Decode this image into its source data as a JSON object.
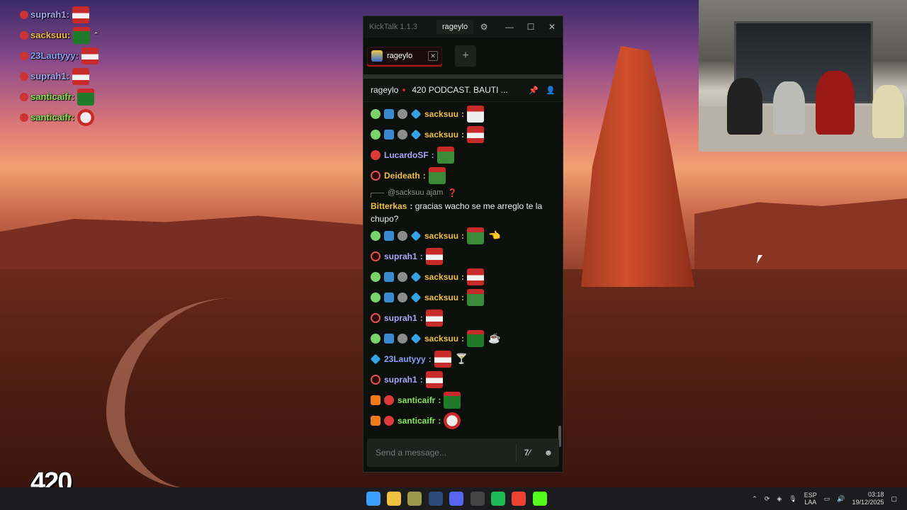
{
  "overlay_chat": [
    {
      "user": "suprah1",
      "color": "#a7a8f5",
      "emote": "em-red",
      "extra": ""
    },
    {
      "user": "sacksuu",
      "color": "#f0c040",
      "emote": "em-green",
      "extra": "ᵔ"
    },
    {
      "user": "23Lautyyy",
      "color": "#8fa2f5",
      "emote": "em-red",
      "extra": ""
    },
    {
      "user": "suprah1",
      "color": "#a7a8f5",
      "emote": "em-red",
      "extra": ""
    },
    {
      "user": "santicaifr",
      "color": "#8be45a",
      "emote": "em-green",
      "extra": ""
    },
    {
      "user": "santicaifr",
      "color": "#8be45a",
      "emote": "em-round",
      "extra": ""
    }
  ],
  "app": {
    "name": "KickTalk 1.1.3",
    "user_button": "rageylo",
    "gear_icon": "⚙",
    "min": "—",
    "max": "☐",
    "close": "✕"
  },
  "tab": {
    "label": "rageylo",
    "close": "✕",
    "add": "+"
  },
  "channel": {
    "name": "rageylo",
    "title": "420 PODCAST. BAUTI ...",
    "pin_icon": "📌",
    "user_icon": "👤"
  },
  "messages": [
    {
      "badges": [
        "b-bot",
        "b-ham",
        "b-coin",
        "b-gem"
      ],
      "user": "sacksuu",
      "color": "#f0c040",
      "emote": "em-white",
      "extra": ""
    },
    {
      "badges": [
        "b-bot",
        "b-ham",
        "b-coin",
        "b-gem"
      ],
      "user": "sacksuu",
      "color": "#f0c040",
      "emote": "em-red",
      "extra": ""
    },
    {
      "badges": [
        "b-skull"
      ],
      "user": "LucardoSF",
      "color": "#a7a8f5",
      "emote": "em-frog",
      "extra": ""
    },
    {
      "badges": [
        "b-ring"
      ],
      "user": "Deideath",
      "color": "#f0c040",
      "emote": "em-frog",
      "extra": ""
    }
  ],
  "reply": {
    "to": "@sacksuu",
    "text": "ajam",
    "icon": "❓"
  },
  "text_message": {
    "user": "Bitterkas",
    "text": "gracias wacho se me arreglo te la chupo?"
  },
  "messages2": [
    {
      "badges": [
        "b-bot",
        "b-ham",
        "b-coin",
        "b-gem"
      ],
      "user": "sacksuu",
      "color": "#f0c040",
      "emote": "em-frog",
      "extra": "👈"
    },
    {
      "badges": [
        "b-ring"
      ],
      "user": "suprah1",
      "color": "#a7a8f5",
      "emote": "em-red",
      "extra": ""
    },
    {
      "badges": [
        "b-bot",
        "b-ham",
        "b-coin",
        "b-gem"
      ],
      "user": "sacksuu",
      "color": "#f0c040",
      "emote": "em-red",
      "extra": ""
    },
    {
      "badges": [
        "b-bot",
        "b-ham",
        "b-coin",
        "b-gem"
      ],
      "user": "sacksuu",
      "color": "#f0c040",
      "emote": "em-frog",
      "extra": ""
    },
    {
      "badges": [
        "b-ring"
      ],
      "user": "suprah1",
      "color": "#a7a8f5",
      "emote": "em-red",
      "extra": ""
    },
    {
      "badges": [
        "b-bot",
        "b-ham",
        "b-coin",
        "b-gem"
      ],
      "user": "sacksuu",
      "color": "#f0c040",
      "emote": "em-green",
      "extra": "☕"
    },
    {
      "badges": [
        "b-gem"
      ],
      "user": "23Lautyyy",
      "color": "#8fa2f5",
      "emote": "em-red",
      "extra": "🍸"
    },
    {
      "badges": [
        "b-ring"
      ],
      "user": "suprah1",
      "color": "#a7a8f5",
      "emote": "em-red",
      "extra": ""
    },
    {
      "badges": [
        "b-7",
        "b-skull"
      ],
      "user": "santicaifr",
      "color": "#8be45a",
      "emote": "em-green",
      "extra": ""
    },
    {
      "badges": [
        "b-7",
        "b-skull"
      ],
      "user": "santicaifr",
      "color": "#8be45a",
      "emote": "em-round",
      "extra": ""
    }
  ],
  "input": {
    "placeholder": "Send a message...",
    "btn1": "7⁄"
  },
  "logo": "420",
  "taskbar": {
    "apps": [
      {
        "name": "windows-start-icon",
        "color": "#3aa0ff"
      },
      {
        "name": "file-explorer-icon",
        "color": "#f0c040"
      },
      {
        "name": "app-icon",
        "color": "#9a9a4a"
      },
      {
        "name": "steam-icon",
        "color": "#2a4a7a"
      },
      {
        "name": "discord-icon",
        "color": "#5865f2"
      },
      {
        "name": "obs-icon",
        "color": "#444"
      },
      {
        "name": "spotify-icon",
        "color": "#1db954"
      },
      {
        "name": "chrome-icon",
        "color": "#ea4335"
      },
      {
        "name": "kick-icon",
        "color": "#53fc18"
      }
    ],
    "lang_top": "ESP",
    "lang_bottom": "LAA",
    "time": "03:18",
    "date": "19/12/2025"
  }
}
